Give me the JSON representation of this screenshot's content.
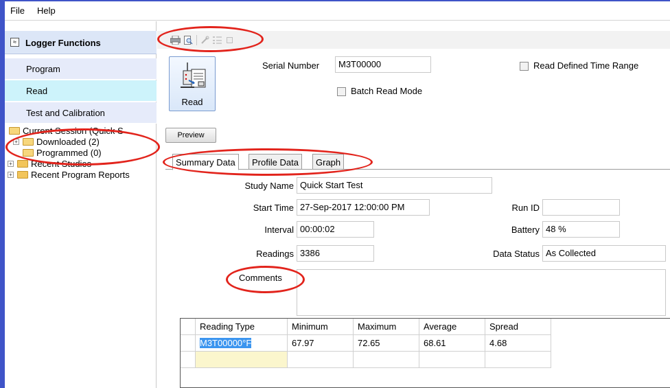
{
  "menu": {
    "file": "File",
    "help": "Help"
  },
  "sidebar": {
    "title": "Logger Functions",
    "collapse_glyph": "≈",
    "items": [
      {
        "label": "Program",
        "active": false
      },
      {
        "label": "Read",
        "active": true
      },
      {
        "label": "Test and Calibration",
        "active": false
      }
    ],
    "tree": {
      "current_session": "Current Session (Quick S",
      "downloaded": "Downloaded  (2)",
      "programmed": "Programmed  (0)",
      "recent_studies": "Recent Studies",
      "recent_program_reports": "Recent Program Reports"
    }
  },
  "toolbar": {
    "icons": [
      "print-icon",
      "print-preview-icon",
      "tool-icon",
      "list-icon",
      "blank-icon"
    ]
  },
  "read_button": {
    "label": "Read"
  },
  "serial": {
    "label": "Serial Number",
    "value": "M3T00000"
  },
  "read_defined_time_range": {
    "label": "Read Defined Time Range",
    "checked": false
  },
  "batch_read_mode": {
    "label": "Batch Read Mode",
    "checked": false
  },
  "preview_button": {
    "label": "Preview"
  },
  "tabs": [
    {
      "label": "Summary Data",
      "active": true
    },
    {
      "label": "Profile Data",
      "active": false
    },
    {
      "label": "Graph",
      "active": false
    }
  ],
  "summary": {
    "study_name": {
      "label": "Study Name",
      "value": "Quick Start Test"
    },
    "start_time": {
      "label": "Start Time",
      "value": "27-Sep-2017 12:00:00 PM"
    },
    "run_id": {
      "label": "Run ID",
      "value": ""
    },
    "interval": {
      "label": "Interval",
      "value": "00:00:02"
    },
    "battery": {
      "label": "Battery",
      "value": "48 %"
    },
    "readings": {
      "label": "Readings",
      "value": "3386"
    },
    "data_status": {
      "label": "Data Status",
      "value": "As Collected"
    },
    "comments": {
      "label": "Comments",
      "value": ""
    }
  },
  "grid": {
    "columns": [
      "Reading Type",
      "Minimum",
      "Maximum",
      "Average",
      "Spread"
    ],
    "rows": [
      [
        "M3T00000°F",
        "67.97",
        "72.65",
        "68.61",
        "4.68"
      ]
    ]
  },
  "colors": {
    "frame": "#3f54c8",
    "annotation": "#e2241c",
    "sidebar_item": "#e6ebfa",
    "sidebar_active": "#cdf3fb",
    "selection": "#3b95ef"
  }
}
